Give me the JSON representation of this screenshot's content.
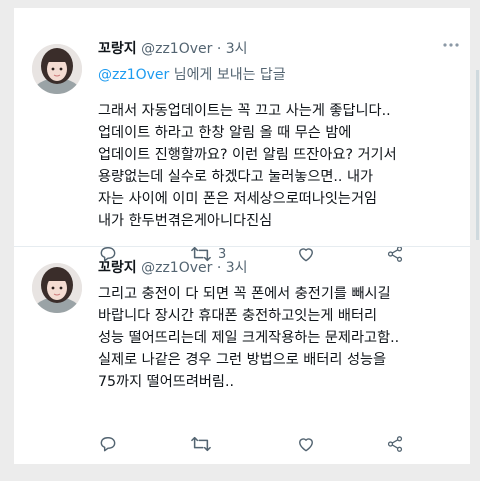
{
  "colors": {
    "accent": "#1d9bf0",
    "muted": "#536471",
    "text": "#0f1419",
    "background": "#ececec",
    "card": "#ffffff"
  },
  "tweets": [
    {
      "name": "꼬랑지",
      "handle": "@zz1Over",
      "dot": "·",
      "time": "3시",
      "reply_to_user": "@zz1Over",
      "reply_to_text": " 님에게 보내는 답글",
      "lines": [
        "그래서 자동업데이트는 꼭 끄고 사는게 좋답니다..",
        "업데이트 하라고 한창 알림 올 때 무슨 밤에",
        "업데이트 진행할까요? 이런 알림 뜨잔아요? 거기서",
        "용량없는데 실수로 하겠다고 눌러놓으면.. 내가",
        "자는 사이에 이미 폰은 저세상으로떠나잇는거임",
        "내가 한두번겪은게아니다진심"
      ],
      "actions": {
        "reply_icon": "reply-icon",
        "retweet_icon": "retweet-icon",
        "retweet_count": "3",
        "like_icon": "heart-icon",
        "share_icon": "share-icon"
      }
    },
    {
      "name": "꼬랑지",
      "handle": "@zz1Over",
      "dot": "·",
      "time": "3시",
      "lines": [
        "그리고 충전이 다 되면 꼭 폰에서 충전기를 빼시길",
        "바랍니다 장시간 휴대폰 충전하고잇는게 배터리",
        "성능 떨어뜨리는데 제일 크게작용하는 문제라고함..",
        "실제로 나같은 경우 그런 방법으로 배터리 성능을",
        "75까지 떨어뜨려버림.."
      ],
      "actions": {
        "reply_icon": "reply-icon",
        "retweet_icon": "retweet-icon",
        "like_icon": "heart-icon",
        "share_icon": "share-icon"
      }
    }
  ]
}
